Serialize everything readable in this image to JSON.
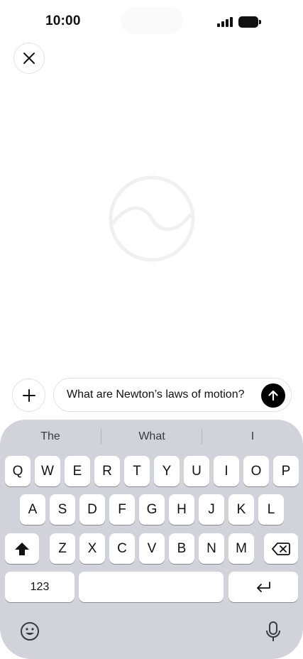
{
  "status_bar": {
    "time": "10:00"
  },
  "composer": {
    "text": "What are Newton’s laws of motion?"
  },
  "keyboard": {
    "suggestions": [
      "The",
      "What",
      "I"
    ],
    "row1": [
      "Q",
      "W",
      "E",
      "R",
      "T",
      "Y",
      "U",
      "I",
      "O",
      "P"
    ],
    "row2": [
      "A",
      "S",
      "D",
      "F",
      "G",
      "H",
      "J",
      "K",
      "L"
    ],
    "row3": [
      "Z",
      "X",
      "C",
      "V",
      "B",
      "N",
      "M"
    ],
    "numbers_label": "123"
  },
  "icons": {
    "close": "close-icon",
    "add": "plus-icon",
    "send": "arrow-up-icon",
    "shift": "shift-icon",
    "delete": "backspace-icon",
    "return": "return-icon",
    "emoji": "emoji-icon",
    "dictation": "microphone-icon"
  }
}
